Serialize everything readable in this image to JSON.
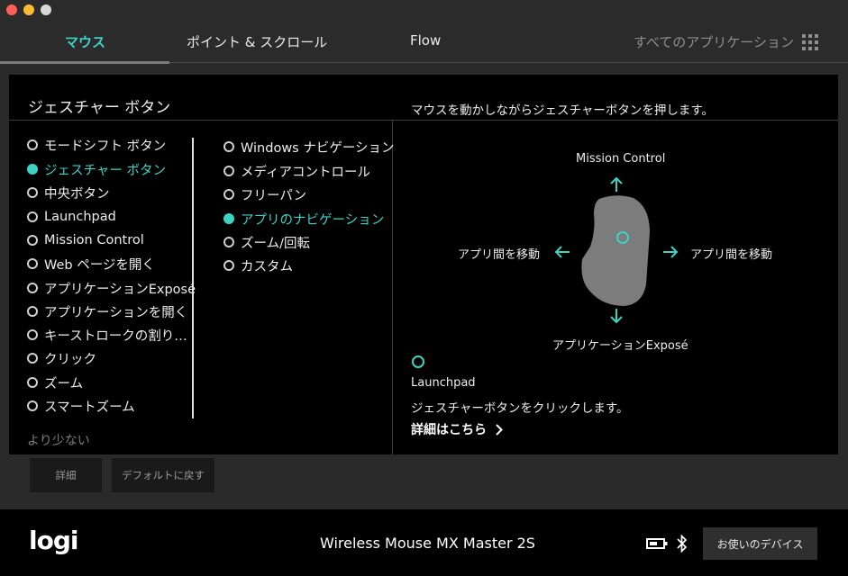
{
  "window": {
    "traffic_lights": [
      "close",
      "minimize",
      "zoom"
    ]
  },
  "tabs": [
    {
      "label": "マウス",
      "active": true
    },
    {
      "label": "ポイント & スクロール",
      "active": false
    },
    {
      "label": "Flow",
      "active": false
    }
  ],
  "all_apps_label": "すべてのアプリケーション",
  "panel": {
    "title": "ジェスチャー ボタン",
    "left_options": [
      {
        "label": "モードシフト ボタン",
        "selected": false
      },
      {
        "label": "ジェスチャー ボタン",
        "selected": true
      },
      {
        "label": "中央ボタン",
        "selected": false
      },
      {
        "label": "Launchpad",
        "selected": false
      },
      {
        "label": "Mission Control",
        "selected": false
      },
      {
        "label": "Web ページを開く",
        "selected": false
      },
      {
        "label": "アプリケーションExposé",
        "selected": false
      },
      {
        "label": "アプリケーションを開く",
        "selected": false
      },
      {
        "label": "キーストロークの割り…",
        "selected": false
      },
      {
        "label": "クリック",
        "selected": false
      },
      {
        "label": "ズーム",
        "selected": false
      },
      {
        "label": "スマートズーム",
        "selected": false
      }
    ],
    "less_label": "より少ない",
    "right_options": [
      {
        "label": "Windows ナビゲーション",
        "selected": false
      },
      {
        "label": "メディアコントロール",
        "selected": false
      },
      {
        "label": "フリーパン",
        "selected": false
      },
      {
        "label": "アプリのナビゲーション",
        "selected": true
      },
      {
        "label": "ズーム/回転",
        "selected": false
      },
      {
        "label": "カスタム",
        "selected": false
      }
    ],
    "instruction": "マウスを動かしながらジェスチャーボタンを押します。",
    "directions": {
      "up": "Mission Control",
      "left": "アプリ間を移動",
      "right": "アプリ間を移動",
      "down": "アプリケーションExposé"
    },
    "click_action": {
      "title": "Launchpad",
      "description": "ジェスチャーボタンをクリックします。"
    },
    "more_link": "詳細はこちら"
  },
  "buttons": {
    "details": "詳細",
    "restore_defaults": "デフォルトに戻す"
  },
  "footer": {
    "logo": "logi",
    "device_name": "Wireless Mouse MX Master 2S",
    "devices_button": "お使いのデバイス"
  },
  "colors": {
    "accent": "#3cd3c4",
    "panel_bg": "#000000",
    "app_bg": "#2a2a2a"
  },
  "icons": [
    "grid-icon",
    "arrow-up-icon",
    "arrow-down-icon",
    "arrow-left-icon",
    "arrow-right-icon",
    "chevron-right-icon",
    "battery-icon",
    "bluetooth-icon"
  ]
}
